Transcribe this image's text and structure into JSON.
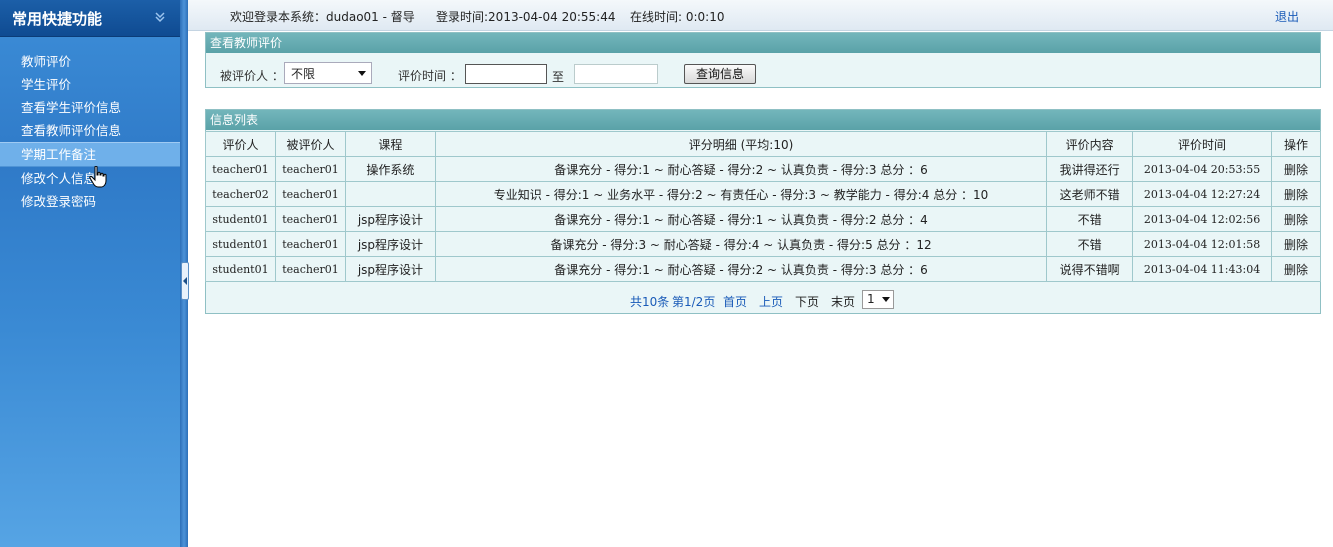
{
  "sidebar": {
    "title": "常用快捷功能",
    "items": [
      {
        "label": "教师评价"
      },
      {
        "label": "学生评价"
      },
      {
        "label": "查看学生评价信息"
      },
      {
        "label": "查看教师评价信息"
      },
      {
        "label": "学期工作备注",
        "active": true
      },
      {
        "label": "修改个人信息"
      },
      {
        "label": "修改登录密码"
      }
    ]
  },
  "topbar": {
    "welcome": "欢迎登录本系统：dudao01 - 督导",
    "login_time": "登录时间:2013-04-04 20:55:44",
    "online_time": "在线时间: 0:0:10",
    "logout": "退出"
  },
  "search": {
    "title": "查看教师评价",
    "evaluatee_label": "被评价人 ：",
    "evaluatee_value": "不限",
    "time_label": "评价时间 ：",
    "to_label": "至",
    "date_from": "",
    "date_to": "",
    "query_button": "查询信息"
  },
  "list": {
    "title": "信息列表",
    "headers": [
      "评价人",
      "被评价人",
      "课程",
      "评分明细 (平均:10)",
      "评价内容",
      "评价时间",
      "操作"
    ],
    "rows": [
      {
        "evaluator": "teacher01",
        "evaluatee": "teacher01",
        "course": "操作系统",
        "detail": "备课充分 - 得分:1 ~ 耐心答疑 - 得分:2 ~ 认真负责 - 得分:3  总分 ：6",
        "content": "我讲得还行",
        "time": "2013-04-04 20:53:55",
        "action": "删除"
      },
      {
        "evaluator": "teacher02",
        "evaluatee": "teacher01",
        "course": "",
        "detail": "专业知识 - 得分:1 ~ 业务水平 - 得分:2 ~ 有责任心 - 得分:3 ~ 教学能力 - 得分:4  总分 ：10",
        "content": "这老师不错",
        "time": "2013-04-04 12:27:24",
        "action": "删除"
      },
      {
        "evaluator": "student01",
        "evaluatee": "teacher01",
        "course": "jsp程序设计",
        "detail": "备课充分 - 得分:1 ~ 耐心答疑 - 得分:1 ~ 认真负责 - 得分:2  总分 ：4",
        "content": "不错",
        "time": "2013-04-04 12:02:56",
        "action": "删除"
      },
      {
        "evaluator": "student01",
        "evaluatee": "teacher01",
        "course": "jsp程序设计",
        "detail": "备课充分 - 得分:3 ~ 耐心答疑 - 得分:4 ~ 认真负责 - 得分:5  总分 ：12",
        "content": "不错",
        "time": "2013-04-04 12:01:58",
        "action": "删除"
      },
      {
        "evaluator": "student01",
        "evaluatee": "teacher01",
        "course": "jsp程序设计",
        "detail": "备课充分 - 得分:1 ~ 耐心答疑 - 得分:2 ~ 认真负责 - 得分:3  总分 ：6",
        "content": "说得不错啊",
        "time": "2013-04-04 11:43:04",
        "action": "删除"
      }
    ]
  },
  "pager": {
    "total": "共10条",
    "page_info": "第1/2页",
    "first": "首页",
    "prev": "上页",
    "next": "下页",
    "last": "末页",
    "current_page": "1"
  }
}
